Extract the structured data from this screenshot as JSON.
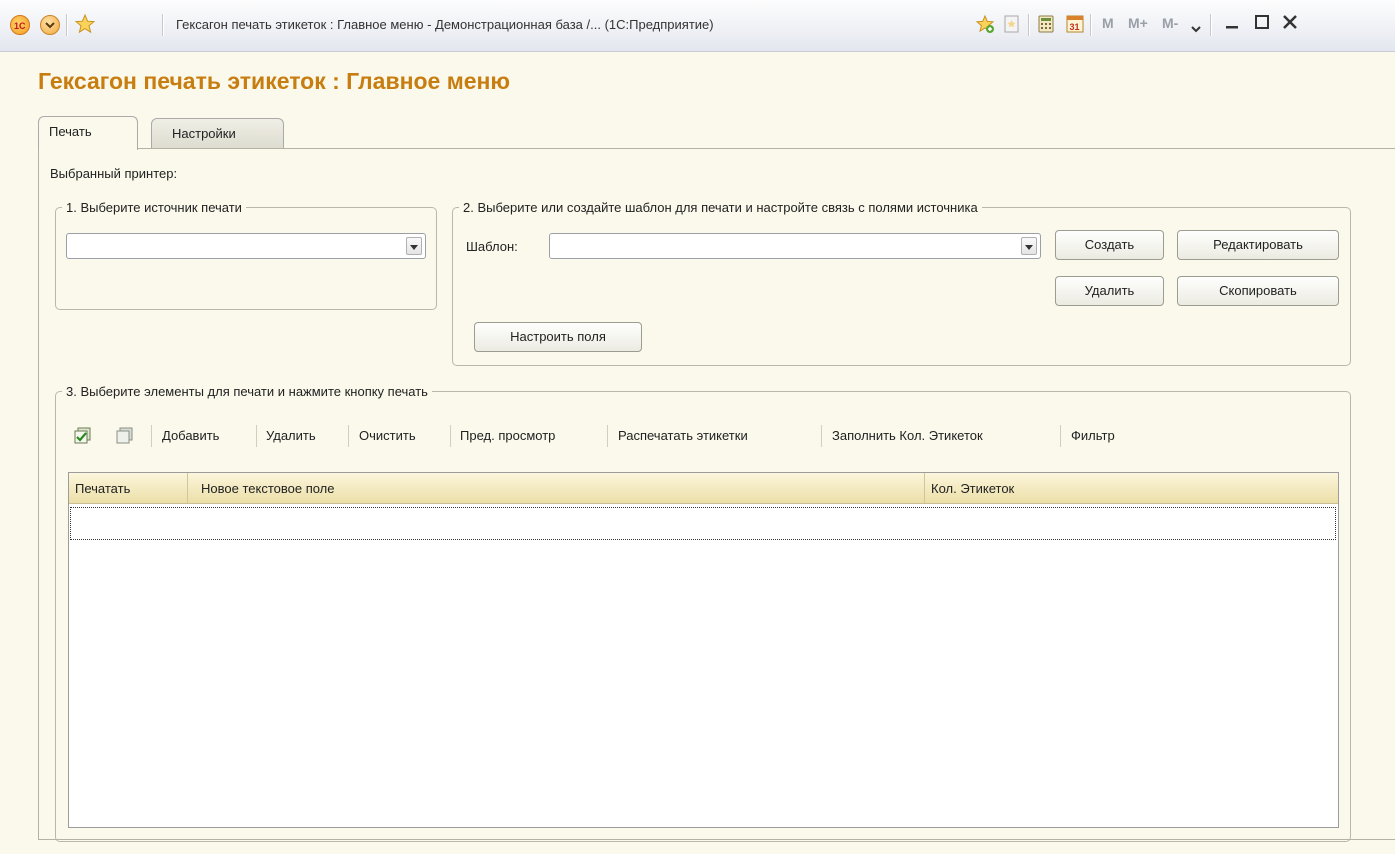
{
  "window": {
    "title": "Гексагон печать этикеток : Главное меню - Демонстрационная база /...  (1С:Предприятие)",
    "mem_buttons": [
      "M",
      "M+",
      "M-"
    ]
  },
  "page": {
    "title": "Гексагон печать этикеток : Главное меню"
  },
  "tabs": [
    {
      "label": "Печать",
      "active": true
    },
    {
      "label": "Настройки",
      "active": false
    }
  ],
  "printer": {
    "label": "Выбранный принтер:"
  },
  "source_group": {
    "legend": "1. Выберите источник печати",
    "value": ""
  },
  "template_group": {
    "legend": "2. Выберите или создайте шаблон для печати и настройте связь с полями источника",
    "template_label": "Шаблон:",
    "template_value": "",
    "create_label": "Создать",
    "edit_label": "Редактировать",
    "delete_label": "Удалить",
    "copy_label": "Скопировать",
    "setup_fields_label": "Настроить поля"
  },
  "elements_group": {
    "legend": "3. Выберите элементы для печати и нажмите кнопку печать",
    "toolbar": {
      "add": "Добавить",
      "delete": "Удалить",
      "clear": "Очистить",
      "preview": "Пред. просмотр",
      "print": "Распечатать этикетки",
      "fill_count": "Заполнить Кол. Этикеток",
      "filter": "Фильтр"
    },
    "columns": [
      "Печатать",
      "Новое текстовое поле",
      "Кол. Этикеток"
    ],
    "rows": []
  },
  "colors": {
    "accent_title": "#c77d0f",
    "background": "#fbf9ec",
    "grid_header": "#ecdfa8"
  }
}
